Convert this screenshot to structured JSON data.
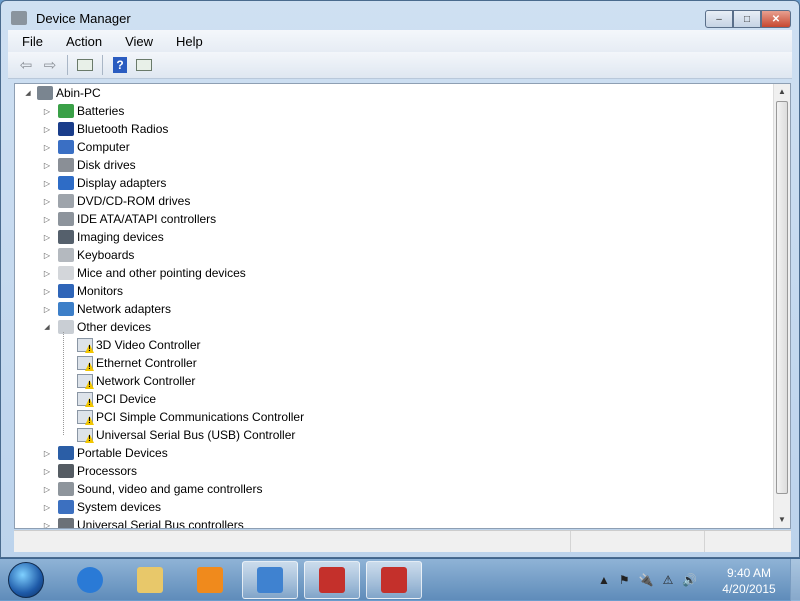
{
  "window": {
    "title": "Device Manager",
    "minimize": "–",
    "maximize": "□",
    "close": "✕"
  },
  "menu": [
    "File",
    "Action",
    "View",
    "Help"
  ],
  "toolbar": {
    "back": "⇦",
    "forward": "⇨",
    "help": "?"
  },
  "tree": {
    "root": "Abin-PC",
    "categories": [
      {
        "label": "Batteries",
        "color": "#3aa047"
      },
      {
        "label": "Bluetooth Radios",
        "color": "#1a3d8a"
      },
      {
        "label": "Computer",
        "color": "#3a6fc4"
      },
      {
        "label": "Disk drives",
        "color": "#8a8f96"
      },
      {
        "label": "Display adapters",
        "color": "#2e6cc6"
      },
      {
        "label": "DVD/CD-ROM drives",
        "color": "#9ea4ab"
      },
      {
        "label": "IDE ATA/ATAPI controllers",
        "color": "#8d949c"
      },
      {
        "label": "Imaging devices",
        "color": "#55606c"
      },
      {
        "label": "Keyboards",
        "color": "#b4b9bf"
      },
      {
        "label": "Mice and other pointing devices",
        "color": "#d3d6da"
      },
      {
        "label": "Monitors",
        "color": "#2f65b8"
      },
      {
        "label": "Network adapters",
        "color": "#3d7fc8"
      },
      {
        "label": "Other devices",
        "color": "#c9ced4",
        "expanded": true,
        "children": [
          "3D Video Controller",
          "Ethernet Controller",
          "Network Controller",
          "PCI Device",
          "PCI Simple Communications Controller",
          "Universal Serial Bus (USB) Controller"
        ]
      },
      {
        "label": "Portable Devices",
        "color": "#2b5ea6"
      },
      {
        "label": "Processors",
        "color": "#555c63"
      },
      {
        "label": "Sound, video and game controllers",
        "color": "#8e959c"
      },
      {
        "label": "System devices",
        "color": "#3c70c0"
      },
      {
        "label": "Universal Serial Bus controllers",
        "color": "#6b7178"
      }
    ]
  },
  "taskbar": {
    "apps": [
      {
        "name": "internet-explorer",
        "color": "#2a7ad6"
      },
      {
        "name": "windows-explorer",
        "color": "#e8c86a"
      },
      {
        "name": "media-player",
        "color": "#f08a1c"
      },
      {
        "name": "control-panel",
        "color": "#3f82d0",
        "active": true
      },
      {
        "name": "device-manager",
        "color": "#c4302b",
        "active": true
      },
      {
        "name": "device-manager-2",
        "color": "#c4302b",
        "active": true
      }
    ],
    "tray": [
      "▲",
      "⚑",
      "🔌",
      "⚠",
      "🔊"
    ],
    "time": "9:40 AM",
    "date": "4/20/2015"
  }
}
